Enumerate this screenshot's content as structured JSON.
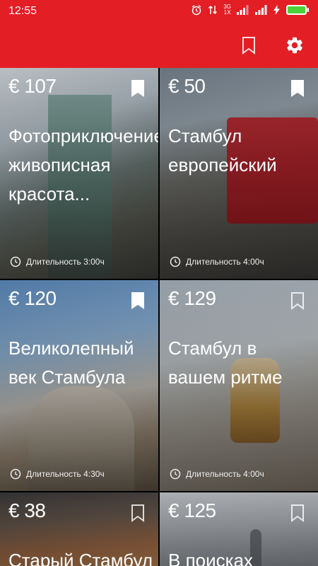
{
  "status_bar": {
    "time": "12:55",
    "network_top": "3G",
    "network_bottom": "1X",
    "colors": {
      "background": "#e31e24",
      "battery": "#4cd137"
    }
  },
  "app_bar": {
    "icons": [
      "bookmark-outline-icon",
      "gear-icon"
    ],
    "color": "#e31e24"
  },
  "tours": [
    {
      "price": "€ 107",
      "title": "Фотоприключение: живописная красота...",
      "duration": "Длительность 3:00ч",
      "bookmarked": true
    },
    {
      "price": "€ 50",
      "title": "Стамбул европейский",
      "duration": "Длительность 4:00ч",
      "bookmarked": true
    },
    {
      "price": "€ 120",
      "title": "Великолепный век Стамбула",
      "duration": "Длительность 4:30ч",
      "bookmarked": true
    },
    {
      "price": "€ 129",
      "title": "Стамбул в вашем ритме",
      "duration": "Длительность 4:00ч",
      "bookmarked": false
    },
    {
      "price": "€ 38",
      "title": "Старый Стамбул",
      "duration": "",
      "bookmarked": false
    },
    {
      "price": "€ 125",
      "title": "В поисках",
      "duration": "",
      "bookmarked": false
    }
  ]
}
